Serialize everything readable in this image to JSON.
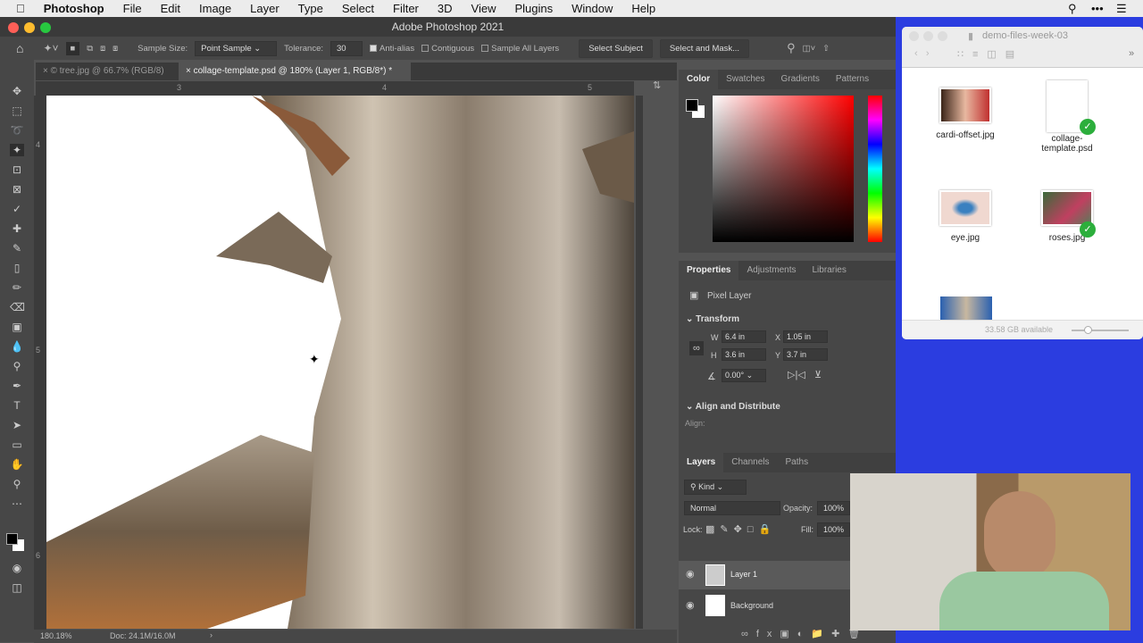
{
  "menubar": {
    "app": "Photoshop",
    "items": [
      "File",
      "Edit",
      "Image",
      "Layer",
      "Type",
      "Select",
      "Filter",
      "3D",
      "View",
      "Plugins",
      "Window",
      "Help"
    ]
  },
  "window": {
    "title": "Adobe Photoshop 2021"
  },
  "options": {
    "sample_size_label": "Sample Size:",
    "sample_size": "Point Sample",
    "tolerance_label": "Tolerance:",
    "tolerance": "30",
    "anti_alias": "Anti-alias",
    "contiguous": "Contiguous",
    "sample_all": "Sample All Layers",
    "select_subject": "Select Subject",
    "select_mask": "Select and Mask..."
  },
  "tabs": [
    {
      "label": "tree.jpg @ 66.7% (RGB/8)",
      "active": false
    },
    {
      "label": "collage-template.psd @ 180% (Layer 1, RGB/8*) *",
      "active": true
    }
  ],
  "ruler": {
    "ticks": [
      "3",
      "4",
      "5"
    ],
    "vticks": [
      "4",
      "5",
      "6"
    ]
  },
  "status": {
    "zoom": "180.18%",
    "doc": "Doc: 24.1M/16.0M"
  },
  "color_panel": {
    "tabs": [
      "Color",
      "Swatches",
      "Gradients",
      "Patterns"
    ]
  },
  "properties": {
    "tabs": [
      "Properties",
      "Adjustments",
      "Libraries"
    ],
    "layer_type": "Pixel Layer",
    "transform": "Transform",
    "w_label": "W",
    "w": "6.4 in",
    "x_label": "X",
    "x": "1.05 in",
    "h_label": "H",
    "h": "3.6 in",
    "y_label": "Y",
    "y": "3.7 in",
    "angle": "0.00°",
    "align_section": "Align and Distribute",
    "align_label": "Align:"
  },
  "layers": {
    "tabs": [
      "Layers",
      "Channels",
      "Paths"
    ],
    "kind": "Kind",
    "blend": "Normal",
    "opacity_label": "Opacity:",
    "opacity": "100%",
    "lock_label": "Lock:",
    "fill_label": "Fill:",
    "fill": "100%",
    "items": [
      {
        "name": "Layer 1"
      },
      {
        "name": "Background"
      }
    ]
  },
  "finder": {
    "title": "demo-files-week-03",
    "files": [
      {
        "name": "cardi-offset.jpg"
      },
      {
        "name": "collage-template.psd"
      },
      {
        "name": "eye.jpg"
      },
      {
        "name": "roses.jpg"
      }
    ],
    "available": "33.58 GB available"
  }
}
